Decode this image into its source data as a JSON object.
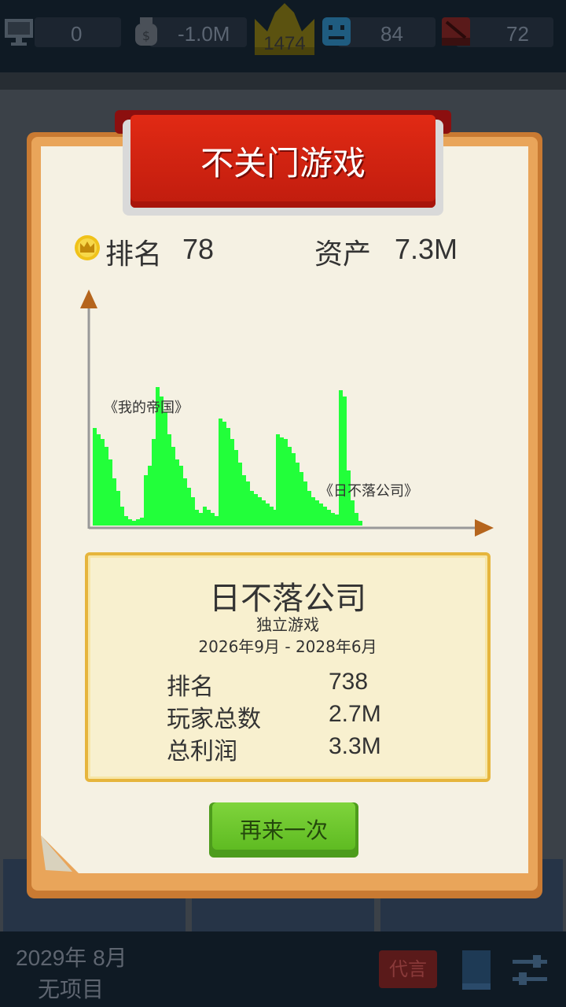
{
  "top_bar": {
    "fans": "0",
    "money": "-1.0M",
    "level": "1474",
    "staff": "84",
    "hearts": "72"
  },
  "dialog": {
    "title": "不关门游戏",
    "rank_label": "排名",
    "rank_value": "78",
    "assets_label": "资产",
    "assets_value": "7.3M",
    "chart_label_1": "《我的帝国》",
    "chart_label_2": "《日不落公司》",
    "game": {
      "name": "日不落公司",
      "genre": "独立游戏",
      "period": "2026年9月 - 2028年6月",
      "stats": [
        {
          "label": "排名",
          "value": "738"
        },
        {
          "label": "玩家总数",
          "value": "2.7M"
        },
        {
          "label": "总利润",
          "value": "3.3M"
        }
      ]
    },
    "retry_label": "再来一次"
  },
  "bottom_bar": {
    "date": "2029年 8月",
    "project_status": "无项目",
    "reputation_label": "代言"
  },
  "colors": {
    "chart_bar": "#22ff3a",
    "chart_axis": "#999999",
    "arrow": "#b5651d"
  },
  "chart_data": {
    "type": "area",
    "series": [
      {
        "name": "《我的帝国》",
        "values": [
          0.62,
          0.58,
          0.55,
          0.5,
          0.42,
          0.3,
          0.22,
          0.12,
          0.06,
          0.04,
          0.03,
          0.04,
          0.05,
          0.32,
          0.38,
          0.55,
          0.88,
          0.82,
          0.72,
          0.58,
          0.5,
          0.42,
          0.38,
          0.3,
          0.24,
          0.18,
          0.1,
          0.08,
          0.12,
          0.1,
          0.08,
          0.06,
          0.68,
          0.66,
          0.62,
          0.55,
          0.48,
          0.4,
          0.32,
          0.28,
          0.22,
          0.2,
          0.18,
          0.16,
          0.14,
          0.12,
          0.1,
          0.08,
          0.06,
          0.04
        ]
      },
      {
        "name": "《日不落公司》",
        "values": [
          0.58,
          0.56,
          0.55,
          0.5,
          0.46,
          0.4,
          0.34,
          0.28,
          0.22,
          0.18,
          0.16,
          0.14,
          0.12,
          0.1,
          0.08,
          0.07,
          0.86,
          0.82,
          0.35,
          0.16,
          0.08,
          0.03
        ]
      }
    ]
  }
}
